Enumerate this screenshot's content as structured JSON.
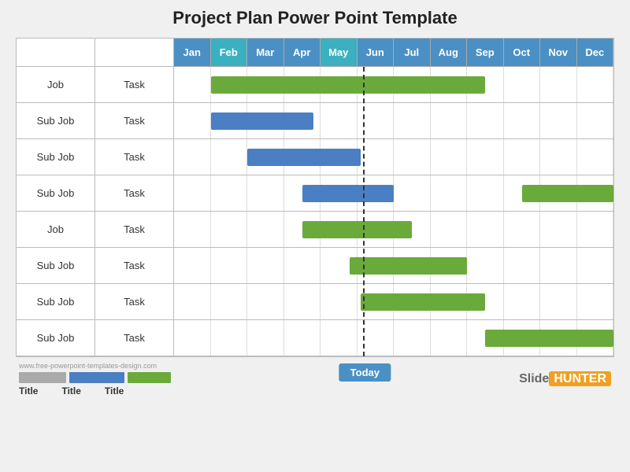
{
  "title": "Project Plan Power Point Template",
  "months": [
    {
      "label": "Jan",
      "style": "blue"
    },
    {
      "label": "Feb",
      "style": "teal"
    },
    {
      "label": "Mar",
      "style": "blue"
    },
    {
      "label": "Apr",
      "style": "blue"
    },
    {
      "label": "May",
      "style": "teal"
    },
    {
      "label": "Jun",
      "style": "blue"
    },
    {
      "label": "Jul",
      "style": "blue"
    },
    {
      "label": "Aug",
      "style": "blue"
    },
    {
      "label": "Sep",
      "style": "blue"
    },
    {
      "label": "Oct",
      "style": "blue"
    },
    {
      "label": "Nov",
      "style": "blue"
    },
    {
      "label": "Dec",
      "style": "blue"
    }
  ],
  "rows": [
    {
      "col1": "Job",
      "col2": "Task",
      "bar": {
        "color": "green",
        "start": 1,
        "end": 8.5
      }
    },
    {
      "col1": "Sub Job",
      "col2": "Task",
      "bar": {
        "color": "blue",
        "start": 1,
        "end": 3.8
      }
    },
    {
      "col1": "Sub Job",
      "col2": "Task",
      "bar": {
        "color": "blue",
        "start": 2,
        "end": 5.1
      }
    },
    {
      "col1": "Sub Job",
      "col2": "Task",
      "bar": {
        "color": "blue",
        "start": 3.5,
        "end": 6
      },
      "bar2": {
        "color": "green",
        "start": 9.5,
        "end": 12
      }
    },
    {
      "col1": "Job",
      "col2": "Task",
      "bar": {
        "color": "green",
        "start": 3.5,
        "end": 6.5
      }
    },
    {
      "col1": "Sub Job",
      "col2": "Task",
      "bar": {
        "color": "green",
        "start": 4.8,
        "end": 8.0
      }
    },
    {
      "col1": "Sub Job",
      "col2": "Task",
      "bar": {
        "color": "green",
        "start": 5.1,
        "end": 8.5
      }
    },
    {
      "col1": "Sub Job",
      "col2": "Task",
      "bar": {
        "color": "green",
        "start": 8.5,
        "end": 12
      }
    }
  ],
  "today": {
    "label": "Today",
    "position": 5.15
  },
  "footer": {
    "watermark": "www.free-powerpoint-templates-design.com",
    "titles": [
      "Title",
      "Title",
      "Title"
    ],
    "logo_slide": "Slide",
    "logo_hunter": "HUNTER"
  }
}
